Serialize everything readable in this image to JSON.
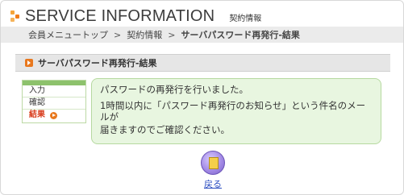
{
  "header": {
    "title": "SERVICE INFORMATION",
    "subtitle": "契約情報"
  },
  "breadcrumb": [
    "会員メニュートップ",
    "契約情報",
    "サーバパスワード再発行-結果"
  ],
  "breadcrumb_separator": ">",
  "section": {
    "title": "サーバパスワード再発行-結果"
  },
  "steps": [
    {
      "label": "入力",
      "active": false
    },
    {
      "label": "確認",
      "active": false
    },
    {
      "label": "結果",
      "active": true
    }
  ],
  "message": {
    "line1": "パスワードの再発行を行いました。",
    "line2": "1時間以内に「パスワード再発行のお知らせ」という件名のメー",
    "line3": "ルが",
    "line4": "届きますのでご確認ください。"
  },
  "back": {
    "label": "戻る"
  },
  "colors": {
    "accent_orange": "#e8781e",
    "step_active": "#d83a1a",
    "message_bg": "#e8f6e0",
    "message_border": "#b6d9a0",
    "link": "#2a4cc0"
  }
}
